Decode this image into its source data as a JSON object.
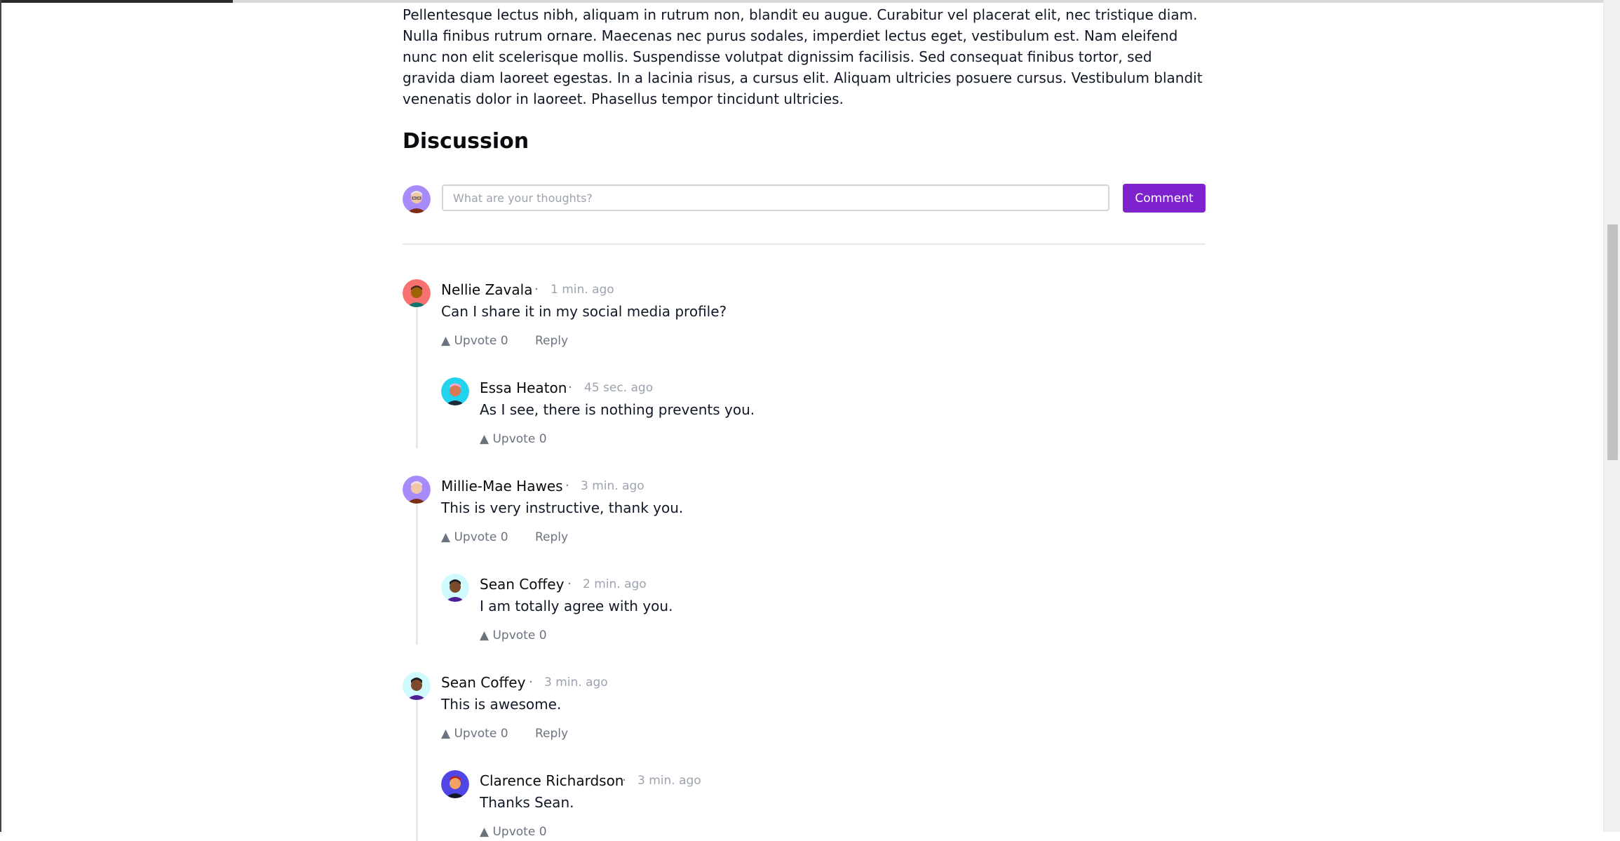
{
  "article": {
    "paragraph": "Pellentesque lectus nibh, aliquam in rutrum non, blandit eu augue. Curabitur vel placerat elit, nec tristique diam. Nulla finibus rutrum ornare. Maecenas nec purus sodales, imperdiet lectus eget, vestibulum est. Nam eleifend nunc non elit scelerisque mollis. Suspendisse volutpat dignissim facilisis. Sed consequat finibus tortor, sed gravida diam laoreet egestas. In a lacinia risus, a cursus elit. Aliquam ultricies posuere cursus. Vestibulum blandit venenatis dolor in laoreet. Phasellus tempor tincidunt ultricies."
  },
  "discussion": {
    "title": "Discussion",
    "input_placeholder": "What are your thoughts?",
    "comment_button": "Comment"
  },
  "separator": "·",
  "comments": [
    {
      "name": "Nellie Zavala",
      "time": "1 min. ago",
      "text": "Can I share it in my social media profile?",
      "upvote": "▲ Upvote 0",
      "reply": "Reply",
      "replies": [
        {
          "name": "Essa Heaton",
          "time": "45 sec. ago",
          "text": "As I see, there is nothing prevents you.",
          "upvote": "▲ Upvote 0"
        }
      ]
    },
    {
      "name": "Millie-Mae Hawes",
      "time": "3 min. ago",
      "text": "This is very instructive, thank you.",
      "upvote": "▲ Upvote 0",
      "reply": "Reply",
      "replies": [
        {
          "name": "Sean Coffey",
          "time": "2 min. ago",
          "text": "I am totally agree with you.",
          "upvote": "▲ Upvote 0"
        }
      ]
    },
    {
      "name": "Sean Coffey",
      "time": "3 min. ago",
      "text": "This is awesome.",
      "upvote": "▲ Upvote 0",
      "reply": "Reply",
      "replies": [
        {
          "name": "Clarence Richardson",
          "time": "3 min. ago",
          "text": "Thanks Sean.",
          "upvote": "▲ Upvote 0"
        }
      ]
    }
  ],
  "colors": {
    "accent": "#7e22ce",
    "muted_text": "#9ca3af",
    "action_text": "#6b7280",
    "thread_line": "#e5e7eb"
  },
  "icons": [
    "user-avatar-icon"
  ]
}
